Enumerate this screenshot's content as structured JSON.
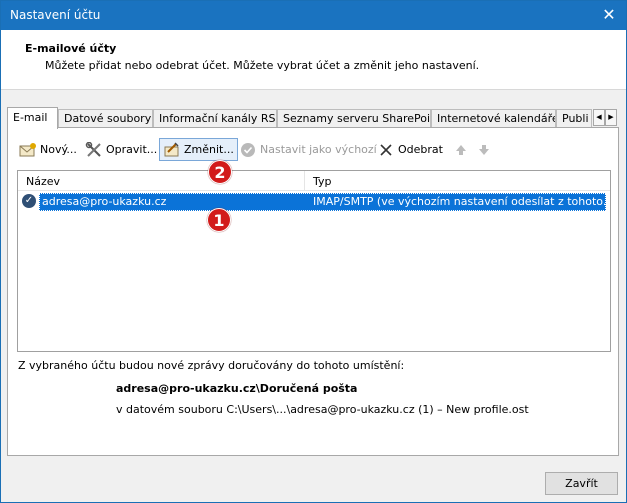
{
  "window": {
    "title": "Nastavení účtu",
    "close_glyph": "✕"
  },
  "header": {
    "title": "E-mailové účty",
    "subtitle": "Můžete přidat nebo odebrat účet. Můžete vybrat účet a změnit jeho nastavení."
  },
  "tabs": [
    {
      "label": "E-mail",
      "active": true
    },
    {
      "label": "Datové soubory",
      "active": false
    },
    {
      "label": "Informační kanály RSS",
      "active": false
    },
    {
      "label": "Seznamy serveru SharePoint",
      "active": false
    },
    {
      "label": "Internetové kalendáře",
      "active": false
    },
    {
      "label": "Publi",
      "active": false
    }
  ],
  "tab_scroll": {
    "left": "◀",
    "right": "▶"
  },
  "toolbar": {
    "new_label": "Nový...",
    "repair_label": "Opravit...",
    "change_label": "Změnit...",
    "set_default_label": "Nastavit jako výchozí",
    "remove_label": "Odebrat",
    "icons": {
      "new": "envelope-icon",
      "repair": "tools-icon",
      "change": "change-icon",
      "set_default": "check-circle-icon",
      "remove": "x-icon",
      "move_up": "arrow-up-icon",
      "move_down": "arrow-down-icon"
    }
  },
  "list": {
    "columns": {
      "name": "Název",
      "type": "Typ"
    },
    "rows": [
      {
        "name": "adresa@pro-ukazku.cz",
        "type": "IMAP/SMTP (ve výchozím nastavení odesílat z tohoto...",
        "default": true,
        "selected": true
      }
    ]
  },
  "markers": {
    "one": "1",
    "two": "2"
  },
  "delivery": {
    "info": "Z vybraného účtu budou nové zprávy doručovány do tohoto umístění:",
    "path": "adresa@pro-ukazku.cz\\Doručená pošta",
    "file": "v datovém souboru C:\\Users\\...\\adresa@pro-ukazku.cz (1) – New profile.ost"
  },
  "footer": {
    "close_label": "Zavřít"
  },
  "colors": {
    "titlebar": "#1a73c0",
    "selection": "#0b73d8",
    "marker": "#d21b1b"
  }
}
